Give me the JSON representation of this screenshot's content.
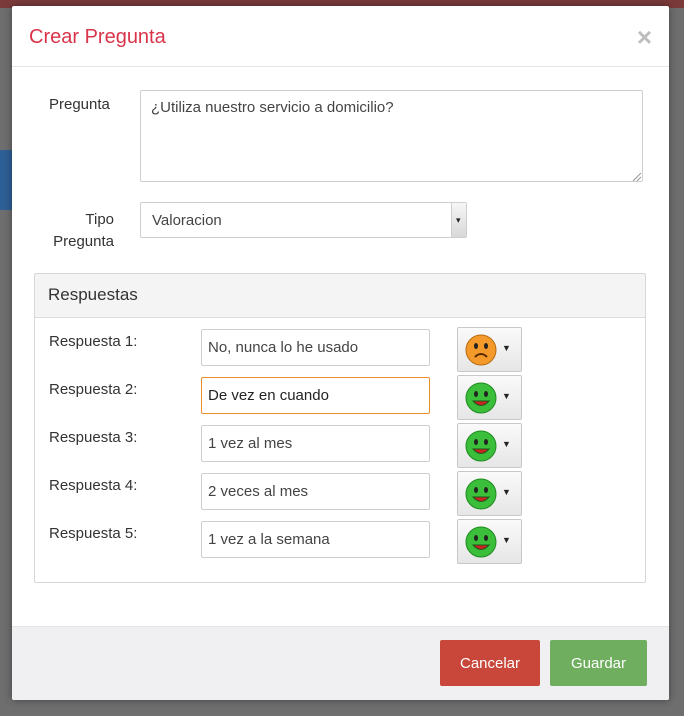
{
  "modal": {
    "title": "Crear Pregunta",
    "close_glyph": "×"
  },
  "form": {
    "pregunta_label": "Pregunta",
    "pregunta_value": "¿Utiliza nuestro servicio a domicilio?",
    "tipo_label_line1": "Tipo",
    "tipo_label_line2": "Pregunta",
    "tipo_value": "Valoracion"
  },
  "respuestas": {
    "title": "Respuestas",
    "items": [
      {
        "label": "Respuesta 1:",
        "value": "No, nunca lo he usado",
        "icon": "sad-face-icon",
        "focused": false
      },
      {
        "label": "Respuesta 2:",
        "value": "De vez en cuando",
        "icon": "happy-face-icon",
        "focused": true
      },
      {
        "label": "Respuesta 3:",
        "value": "1 vez al mes",
        "icon": "happy-face-icon",
        "focused": false
      },
      {
        "label": "Respuesta 4:",
        "value": "2 veces al mes",
        "icon": "happy-face-icon",
        "focused": false
      },
      {
        "label": "Respuesta 5:",
        "value": "1 vez a la semana",
        "icon": "happy-face-icon",
        "focused": false
      }
    ]
  },
  "footer": {
    "cancel_label": "Cancelar",
    "save_label": "Guardar"
  },
  "colors": {
    "title": "#d9344a",
    "cancel": "#c8473a",
    "save": "#6fad5f",
    "focus": "#e9902c",
    "happy": "#3bbf3b",
    "sad": "#f39a2b"
  }
}
